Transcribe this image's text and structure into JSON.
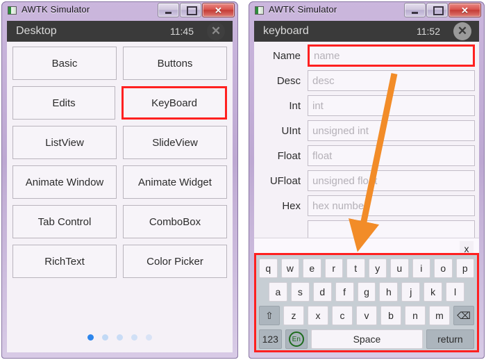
{
  "left_window": {
    "os_title": "AWTK Simulator",
    "app_icon": "awtk-app-icon",
    "buttons": {
      "minimize": "minimize-icon",
      "maximize": "maximize-icon",
      "close": "✕"
    },
    "statusbar": {
      "title": "Desktop",
      "time": "11:45",
      "close": "✕"
    },
    "grid": [
      [
        {
          "label": "Basic",
          "highlighted": false
        },
        {
          "label": "Buttons",
          "highlighted": false
        }
      ],
      [
        {
          "label": "Edits",
          "highlighted": false
        },
        {
          "label": "KeyBoard",
          "highlighted": true
        }
      ],
      [
        {
          "label": "ListView",
          "highlighted": false
        },
        {
          "label": "SlideView",
          "highlighted": false
        }
      ],
      [
        {
          "label": "Animate Window",
          "highlighted": false
        },
        {
          "label": "Animate Widget",
          "highlighted": false
        }
      ],
      [
        {
          "label": "Tab Control",
          "highlighted": false
        },
        {
          "label": "ComboBox",
          "highlighted": false
        }
      ],
      [
        {
          "label": "RichText",
          "highlighted": false
        },
        {
          "label": "Color Picker",
          "highlighted": false
        }
      ]
    ],
    "page_dots": {
      "count": 5,
      "active_index": 0
    }
  },
  "right_window": {
    "os_title": "AWTK Simulator",
    "app_icon": "awtk-app-icon",
    "buttons": {
      "minimize": "minimize-icon",
      "maximize": "maximize-icon",
      "close": "✕"
    },
    "statusbar": {
      "title": "keyboard",
      "time": "11:52",
      "close": "✕"
    },
    "form": [
      {
        "label": "Name",
        "placeholder": "name",
        "focused": true
      },
      {
        "label": "Desc",
        "placeholder": "desc",
        "focused": false
      },
      {
        "label": "Int",
        "placeholder": "int",
        "focused": false
      },
      {
        "label": "UInt",
        "placeholder": "unsigned int",
        "focused": false
      },
      {
        "label": "Float",
        "placeholder": "float",
        "focused": false
      },
      {
        "label": "UFloat",
        "placeholder": "unsigned float",
        "focused": false
      },
      {
        "label": "Hex",
        "placeholder": "hex number",
        "focused": false
      }
    ],
    "keyboard_close_label": "x",
    "keyboard": {
      "row1": [
        "q",
        "w",
        "e",
        "r",
        "t",
        "y",
        "u",
        "i",
        "o",
        "p"
      ],
      "row2": [
        "a",
        "s",
        "d",
        "f",
        "g",
        "h",
        "j",
        "k",
        "l"
      ],
      "row3_shift": "⇧",
      "row3": [
        "z",
        "x",
        "c",
        "v",
        "b",
        "n",
        "m"
      ],
      "row3_backspace": "⌫",
      "row4_numeric": "123",
      "row4_lang": "En",
      "row4_space": "Space",
      "row4_return": "return"
    }
  },
  "annotation": {
    "arrow_color": "#f28c28",
    "highlight_color": "#ff2020"
  }
}
